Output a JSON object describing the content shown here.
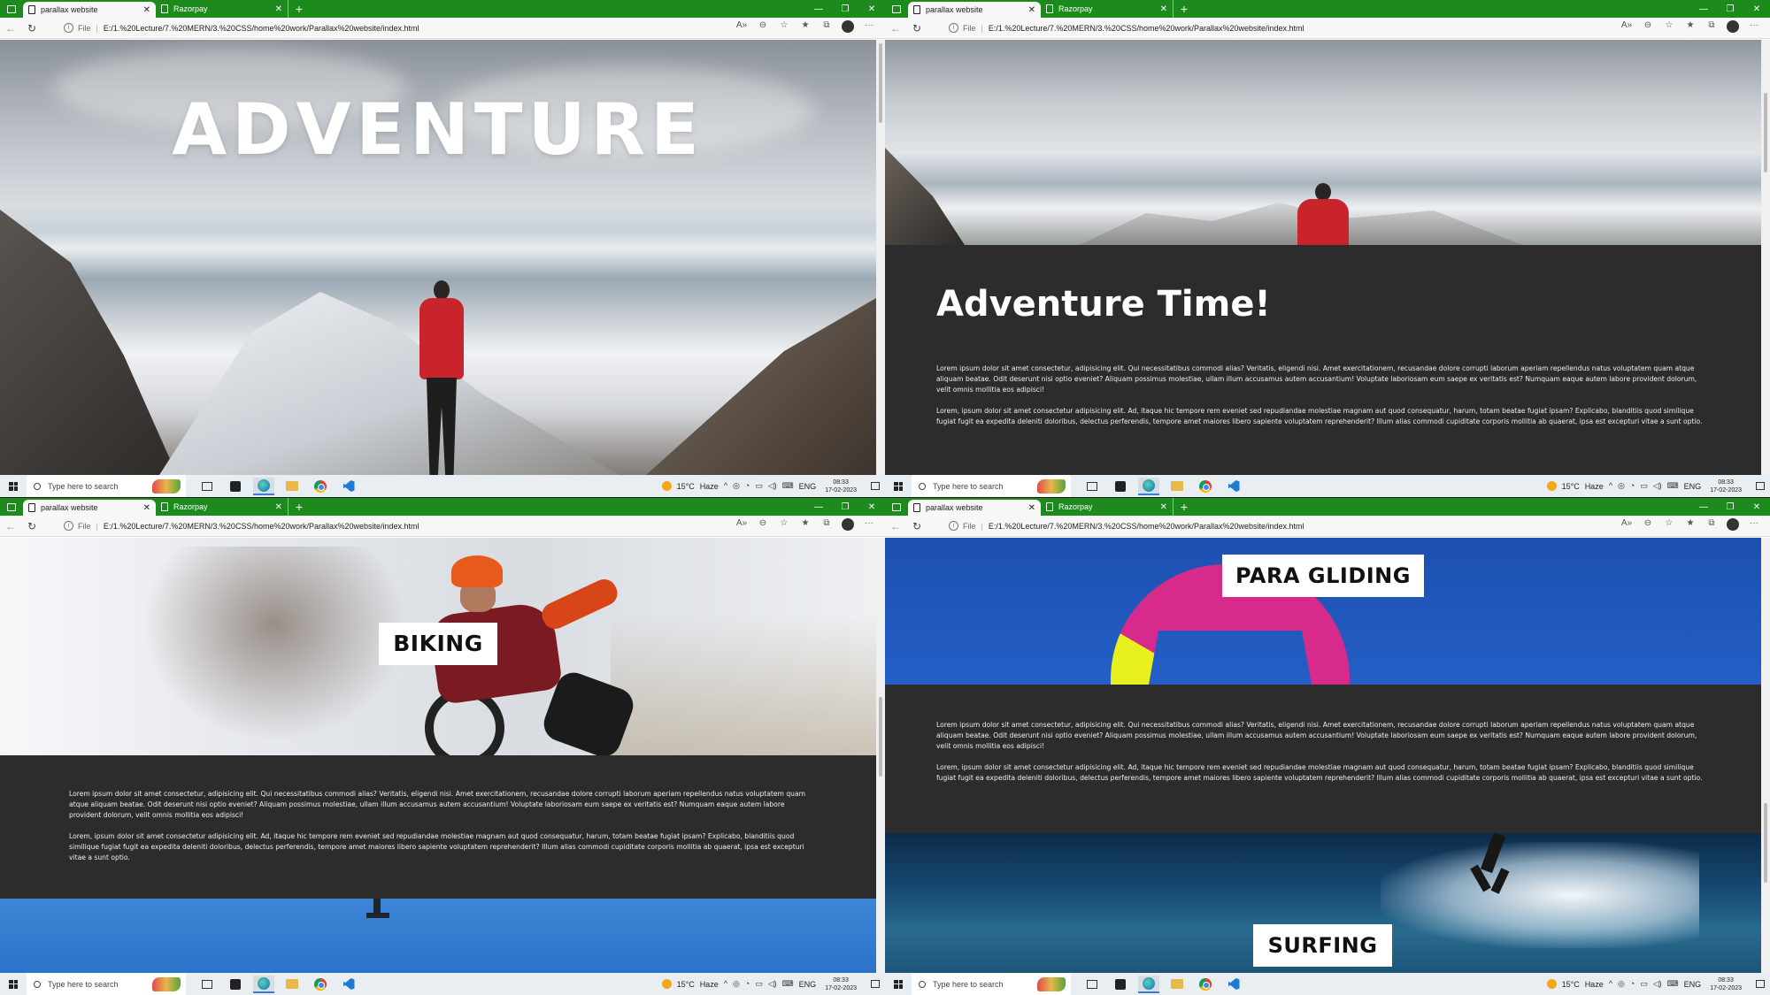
{
  "browser": {
    "tabs": [
      {
        "label": "parallax website",
        "active": true
      },
      {
        "label": "Razorpay",
        "active": false
      }
    ],
    "address": {
      "file_label": "File",
      "url": "E:/1.%20Lecture/7.%20MERN/3.%20CSS/home%20work/Parallax%20website/index.html"
    },
    "colors": {
      "tab_bar": "#1d8a1d"
    }
  },
  "taskbar": {
    "search_placeholder": "Type here to search",
    "weather_temp": "15°C",
    "weather_desc": "Haze",
    "language": "ENG",
    "time": "08:33",
    "date": "17-02-2023"
  },
  "hero": {
    "title": "ADVENTURE"
  },
  "section_adventure": {
    "heading": "Adventure Time!",
    "paragraphs": [
      "Lorem ipsum dolor sit amet consectetur, adipisicing elit. Qui necessitatibus commodi alias? Veritatis, eligendi nisi. Amet exercitationem, recusandae dolore corrupti laborum aperiam repellendus natus voluptatem quam atque aliquam beatae. Odit deserunt nisi optio eveniet? Aliquam possimus molestiae, ullam illum accusamus autem accusantium! Voluptate laboriosam eum saepe ex veritatis est? Numquam eaque autem labore provident dolorum, velit omnis mollitia eos adipisci!",
      "Lorem, ipsum dolor sit amet consectetur adipisicing elit. Ad, itaque hic tempore rem eveniet sed repudiandae molestiae magnam aut quod consequatur, harum, totam beatae fugiat ipsam? Explicabo, blanditiis quod similique fugiat fugit ea expedita deleniti doloribus, delectus perferendis, tempore amet maiores libero sapiente voluptatem reprehenderit? Illum alias commodi cupiditate corporis mollitia ab quaerat, ipsa est excepturi vitae a sunt optio."
    ]
  },
  "section_biking": {
    "label": "BIKING"
  },
  "section_paragliding": {
    "label": "PARA GLIDING"
  },
  "section_surfing": {
    "label": "SURFING"
  }
}
